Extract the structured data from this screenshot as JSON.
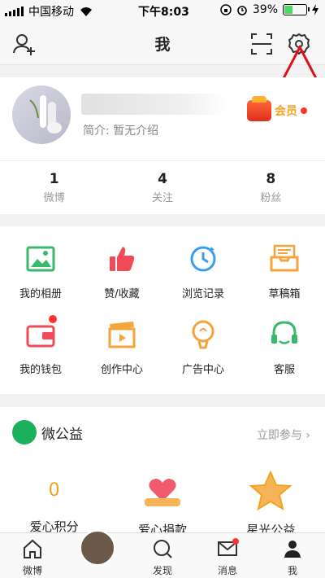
{
  "status": {
    "carrier": "中国移动",
    "time": "下午8:03",
    "battery": "39%",
    "battery_level": 0.39
  },
  "nav": {
    "title": "我"
  },
  "profile": {
    "bio": "简介: 暂无介绍",
    "member_label": "会员",
    "stats": [
      {
        "num": "1",
        "label": "微博"
      },
      {
        "num": "4",
        "label": "关注"
      },
      {
        "num": "8",
        "label": "粉丝"
      }
    ]
  },
  "grid": [
    {
      "label": "我的相册"
    },
    {
      "label": "赞/收藏"
    },
    {
      "label": "浏览记录"
    },
    {
      "label": "草稿箱"
    },
    {
      "label": "我的钱包"
    },
    {
      "label": "创作中心"
    },
    {
      "label": "广告中心"
    },
    {
      "label": "客服"
    }
  ],
  "charity": {
    "title": "微公益",
    "join": "立即参与 ›",
    "points_value": "0",
    "items": [
      "爱心积分",
      "爱心捐款",
      "星光公益"
    ]
  },
  "tabs": [
    {
      "label": "微博"
    },
    {
      "label": ""
    },
    {
      "label": "发现"
    },
    {
      "label": "消息"
    },
    {
      "label": "我"
    }
  ],
  "colors": {
    "accent": "#f4a21d",
    "badge": "#ff3333",
    "green": "#1bb15c"
  }
}
